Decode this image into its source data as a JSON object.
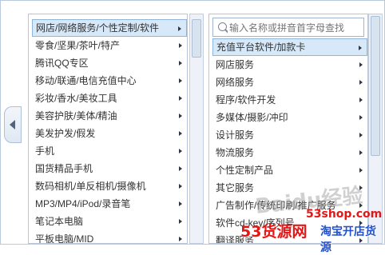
{
  "left_menu": {
    "items": [
      {
        "label": "网店/网络服务/个性定制/软件",
        "selected": true
      },
      {
        "label": "零食/坚果/茶叶/特产"
      },
      {
        "label": "腾讯QQ专区"
      },
      {
        "label": "移动/联通/电信充值中心"
      },
      {
        "label": "彩妆/香水/美妆工具"
      },
      {
        "label": "美容护肤/美体/精油"
      },
      {
        "label": "美发护发/假发"
      },
      {
        "label": "手机"
      },
      {
        "label": "国货精品手机"
      },
      {
        "label": "数码相机/单反相机/摄像机"
      },
      {
        "label": "MP3/MP4/iPod/录音笔"
      },
      {
        "label": "笔记本电脑"
      },
      {
        "label": "平板电脑/MID"
      }
    ]
  },
  "right_menu": {
    "search_placeholder": "输入名称或拼音首字母查找",
    "items": [
      {
        "label": "充值平台软件/加款卡",
        "selected": true
      },
      {
        "label": "网店服务"
      },
      {
        "label": "网络服务"
      },
      {
        "label": "程序/软件开发"
      },
      {
        "label": "多媒体/摄影/冲印"
      },
      {
        "label": "设计服务"
      },
      {
        "label": "物流服务"
      },
      {
        "label": "个性定制产品"
      },
      {
        "label": "其它服务"
      },
      {
        "label": "广告制作/传统印刷/推广服务"
      },
      {
        "label": "软件cd-key/序列号"
      },
      {
        "label": "翻译服务"
      }
    ]
  },
  "watermark": {
    "baidu": "Baidu经验",
    "url": "53shop.com",
    "brand": "53货源网",
    "shop": "淘宝开店货源"
  },
  "colors": {
    "selected_bg": "#d7e8f8",
    "border": "#b8c6da",
    "watermark_red": "#e51616",
    "watermark_blue": "#2450c8"
  }
}
